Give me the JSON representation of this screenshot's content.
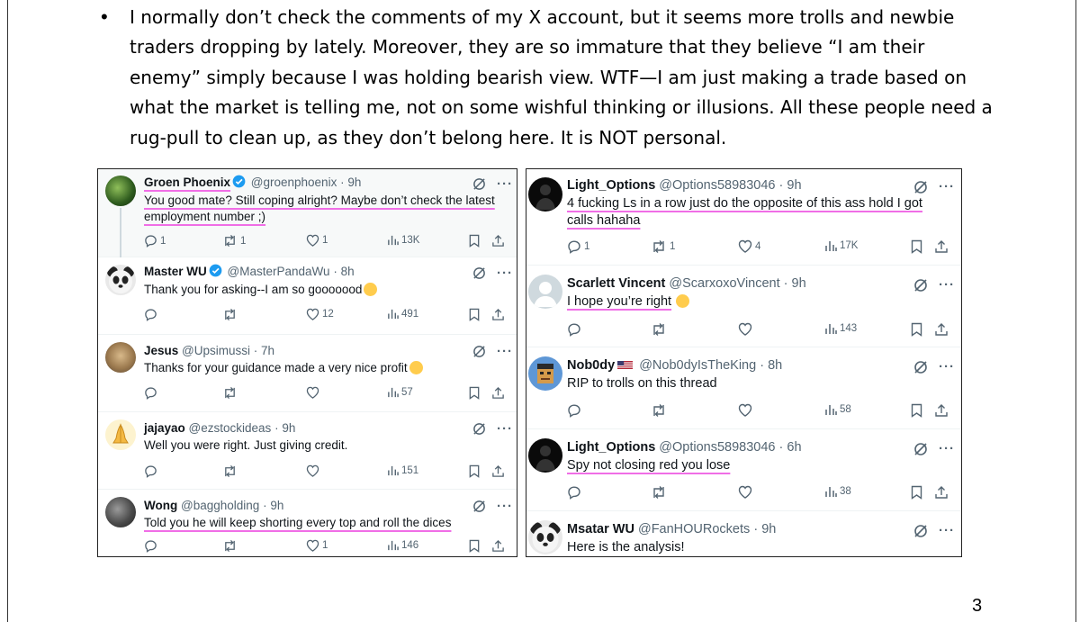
{
  "doc": {
    "bullet_text": "I normally don’t check the comments of my X account, but it seems more trolls and newbie traders dropping by lately. Moreover, they are so immature that they believe “I am their enemy” simply because I was holding bearish view. WTF—I am just making a trade based on what the market is telling me, not on some wishful thinking or illusions. All these people need a rug-pull to clean up, as they don’t belong here. It is NOT personal.",
    "page_number": "3"
  },
  "left_panel": {
    "tweets": [
      {
        "name": "Groen Phoenix",
        "handle": "@groenphoenix",
        "sep": "·",
        "time": "9h",
        "text": "You good mate? Still coping alright? Maybe don’t check the latest employment number ;)",
        "replies": "1",
        "reposts": "1",
        "likes": "1",
        "views": "13K"
      },
      {
        "name": "Master WU",
        "handle": "@MasterPandaWu",
        "sep": "·",
        "time": "8h",
        "text": "Thank you for asking--I am so gooooood",
        "replies": "",
        "reposts": "",
        "likes": "12",
        "views": "491"
      },
      {
        "name": "Jesus",
        "handle": "@Upsimussi",
        "sep": "·",
        "time": "7h",
        "text": "Thanks for your guidance made a very nice profit",
        "replies": "",
        "reposts": "",
        "likes": "",
        "views": "57"
      },
      {
        "name": "jajayao",
        "handle": "@ezstockideas",
        "sep": "·",
        "time": "9h",
        "text": "Well you were right. Just giving credit.",
        "replies": "",
        "reposts": "",
        "likes": "",
        "views": "151"
      },
      {
        "name": "Wong",
        "handle": "@baggholding",
        "sep": "·",
        "time": "9h",
        "text": "Told you he will keep shorting every top and roll the dices",
        "replies": "",
        "reposts": "",
        "likes": "1",
        "views": "146"
      }
    ]
  },
  "right_panel": {
    "tweets": [
      {
        "name": "Light_Options",
        "handle": "@Options58983046",
        "sep": "·",
        "time": "9h",
        "text": "4 fucking Ls in a row just do the opposite of this ass hold I got calls hahaha",
        "replies": "1",
        "reposts": "1",
        "likes": "4",
        "views": "17K"
      },
      {
        "name": "Scarlett Vincent",
        "handle": "@ScarxoxoVincent",
        "sep": "·",
        "time": "9h",
        "text": "I hope you’re right",
        "replies": "",
        "reposts": "",
        "likes": "",
        "views": "143"
      },
      {
        "name": "Nob0dy",
        "handle": "@Nob0dyIsTheKing",
        "sep": "·",
        "time": "8h",
        "text": "RIP to trolls on this thread",
        "replies": "",
        "reposts": "",
        "likes": "",
        "views": "58"
      },
      {
        "name": "Light_Options",
        "handle": "@Options58983046",
        "sep": "·",
        "time": "6h",
        "text": "Spy not closing red you lose",
        "replies": "",
        "reposts": "",
        "likes": "",
        "views": "38"
      },
      {
        "name": "Msatar WU",
        "handle": "@FanHOURockets",
        "sep": "·",
        "time": "9h",
        "text": "Here is the analysis!",
        "replies": "",
        "reposts": "",
        "likes": "",
        "views": ""
      }
    ]
  }
}
